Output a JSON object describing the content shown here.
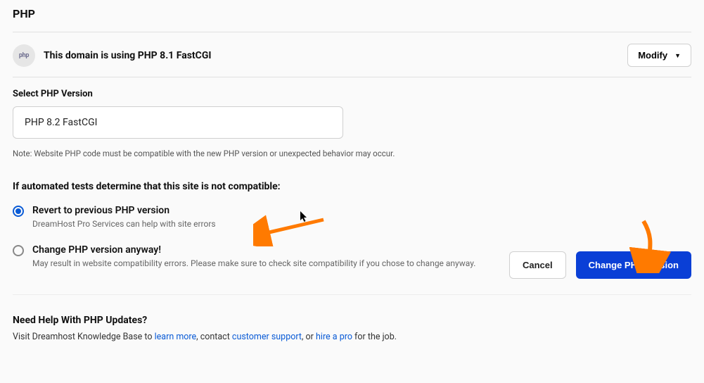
{
  "section": {
    "title": "PHP"
  },
  "status": {
    "icon_label": "php",
    "text": "This domain is using PHP 8.1 FastCGI",
    "modify_label": "Modify"
  },
  "select": {
    "label": "Select PHP Version",
    "value": "PHP 8.2 FastCGI",
    "note": "Note: Website PHP code must be compatible with the new PHP version or unexpected behavior may occur."
  },
  "compat": {
    "heading": "If automated tests determine that this site is not compatible:",
    "options": [
      {
        "label": "Revert to previous PHP version",
        "sub": "DreamHost Pro Services can help with site errors",
        "checked": true
      },
      {
        "label": "Change PHP version anyway!",
        "sub": "May result in website compatibility errors. Please make sure to check site compatibility if you chose to change anyway.",
        "checked": false
      }
    ]
  },
  "actions": {
    "cancel": "Cancel",
    "confirm": "Change PHP Version"
  },
  "help": {
    "heading": "Need Help With PHP Updates?",
    "prefix": "Visit Dreamhost Knowledge Base to ",
    "learn_more": "learn more",
    "mid1": ", contact ",
    "support": "customer support",
    "mid2": ", or ",
    "hire": "hire a pro",
    "suffix": " for the job."
  }
}
